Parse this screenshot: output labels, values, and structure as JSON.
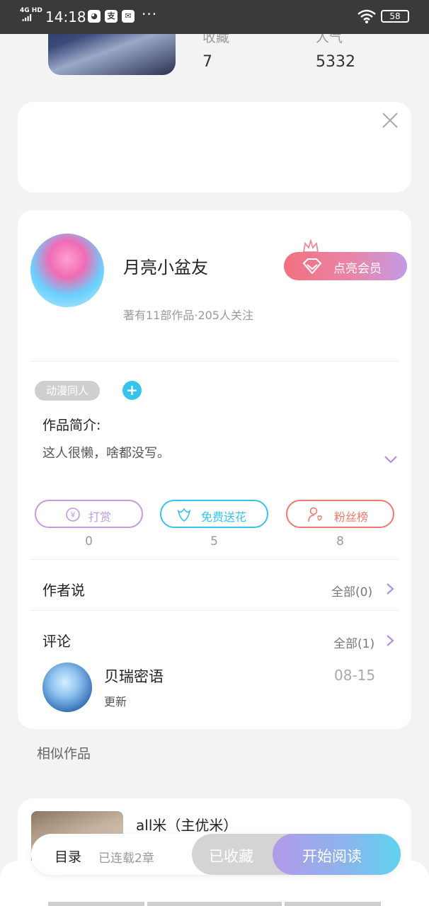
{
  "status_bar": {
    "network": "4G HD",
    "time": "14:18",
    "app_icon_text": "支",
    "dots": "···",
    "battery": "58"
  },
  "book": {
    "stats": [
      {
        "label": "收藏",
        "value": "7"
      },
      {
        "label": "人气",
        "value": "5332"
      }
    ]
  },
  "author": {
    "name": "月亮小盆友",
    "meta": "著有11部作品·205人关注",
    "vip_label": "点亮会员"
  },
  "tags": [
    "动漫同人"
  ],
  "add_tag_symbol": "+",
  "intro": {
    "label": "作品简介:",
    "text": "这人很懒，啥都没写。"
  },
  "actions": [
    {
      "label": "打赏",
      "count": "0",
      "color": "#c49ae2",
      "icon": "yen-coin-icon"
    },
    {
      "label": "免费送花",
      "count": "5",
      "color": "#35c4ec",
      "icon": "flower-icon"
    },
    {
      "label": "粉丝榜",
      "count": "8",
      "color": "#ee7a6e",
      "icon": "fan-person-icon"
    }
  ],
  "author_says": {
    "title": "作者说",
    "link": "全部(0)"
  },
  "comments": {
    "title": "评论",
    "link": "全部(1)",
    "items": [
      {
        "user": "贝瑞密语",
        "text": "更新",
        "date": "08-15"
      }
    ]
  },
  "similar": {
    "title": "相似作品",
    "items": [
      {
        "name": "all米（主优米）"
      }
    ]
  },
  "bottom_bar": {
    "toc_label": "目录",
    "chapter_info": "已连载2章",
    "favorited_label": "已收藏",
    "read_label": "开始阅读"
  },
  "colors": {
    "accent_purple": "#c49ae2",
    "accent_cyan": "#35c4ec",
    "accent_pink": "#ee7a6e"
  }
}
